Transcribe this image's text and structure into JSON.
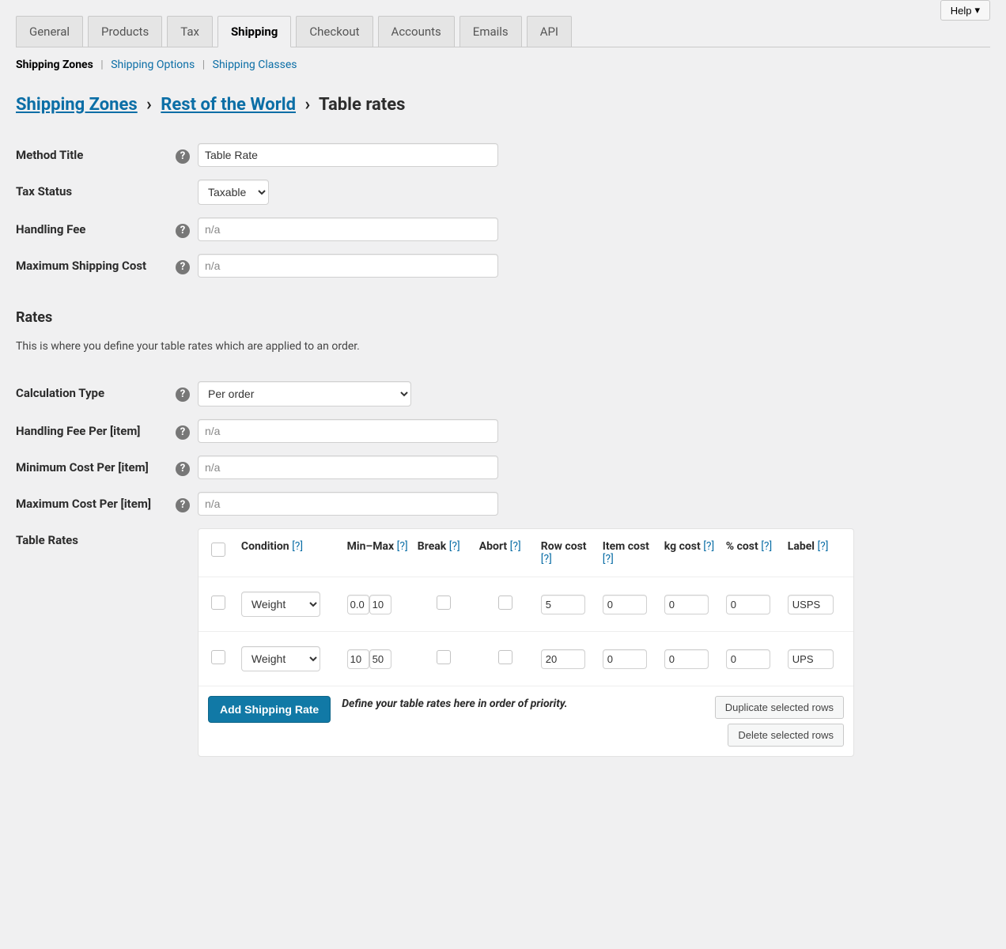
{
  "help_button": "Help",
  "tabs": [
    "General",
    "Products",
    "Tax",
    "Shipping",
    "Checkout",
    "Accounts",
    "Emails",
    "API"
  ],
  "active_tab": "Shipping",
  "subsub": {
    "zones": "Shipping Zones",
    "options": "Shipping Options",
    "classes": "Shipping Classes"
  },
  "breadcrumb": {
    "zones": "Shipping Zones",
    "zone": "Rest of the World",
    "method": "Table rates"
  },
  "fields": {
    "method_title": {
      "label": "Method Title",
      "value": "Table Rate"
    },
    "tax_status": {
      "label": "Tax Status",
      "value": "Taxable"
    },
    "handling_fee": {
      "label": "Handling Fee",
      "placeholder": "n/a"
    },
    "max_ship_cost": {
      "label": "Maximum Shipping Cost",
      "placeholder": "n/a"
    },
    "calc_type": {
      "label": "Calculation Type",
      "value": "Per order"
    },
    "handling_per": {
      "label": "Handling Fee Per [item]",
      "placeholder": "n/a"
    },
    "min_cost_per": {
      "label": "Minimum Cost Per [item]",
      "placeholder": "n/a"
    },
    "max_cost_per": {
      "label": "Maximum Cost Per [item]",
      "placeholder": "n/a"
    },
    "table_rates_label": "Table Rates"
  },
  "section": {
    "rates_title": "Rates",
    "rates_desc": "This is where you define your table rates which are applied to an order."
  },
  "table": {
    "headers": {
      "condition": "Condition",
      "minmax": "Min–Max",
      "break": "Break",
      "abort": "Abort",
      "rowcost": "Row cost",
      "itemcost": "Item cost",
      "kgcost": "kg cost",
      "pctcost": "% cost",
      "label": "Label"
    },
    "help": "[?]",
    "rows": [
      {
        "condition": "Weight",
        "min": "0.0",
        "max": "10",
        "break": false,
        "abort": false,
        "row": "5",
        "item": "0",
        "kg": "0",
        "pct": "0",
        "label": "USPS"
      },
      {
        "condition": "Weight",
        "min": "10",
        "max": "50",
        "break": false,
        "abort": false,
        "row": "20",
        "item": "0",
        "kg": "0",
        "pct": "0",
        "label": "UPS"
      }
    ],
    "footer": {
      "add": "Add Shipping Rate",
      "note": "Define your table rates here in order of priority.",
      "duplicate": "Duplicate selected rows",
      "delete": "Delete selected rows"
    }
  }
}
